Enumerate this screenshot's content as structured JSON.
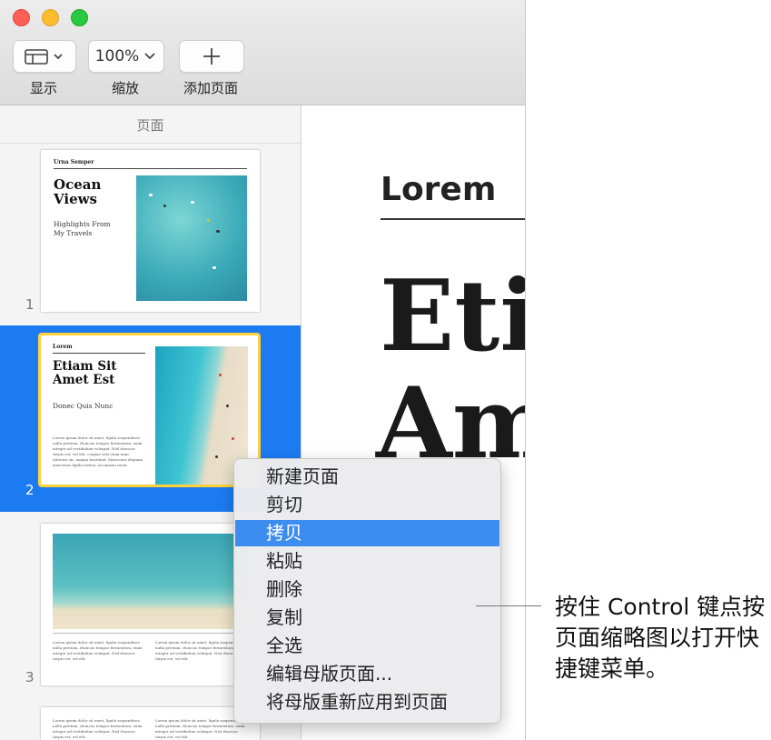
{
  "toolbar": {
    "view_label": "显示",
    "zoom_value": "100%",
    "zoom_label": "缩放",
    "add_page_label": "添加页面"
  },
  "sidebar": {
    "title": "页面",
    "pages": [
      {
        "number": "1",
        "kicker": "Urna Semper",
        "title": "Ocean Views",
        "subtitle": "Highlights From My Travels"
      },
      {
        "number": "2",
        "kicker": "Lorem",
        "title": "Etiam Sit Amet Est",
        "subtitle": "Donec Quis Nunc",
        "body": "Lorem ipsum dolor sit amet, ligula suspendisse nulla pretium, rhoncus tempor fermentum, enim integer ad vestibulum volutpat. Nisl rhoncus turpis est, vel elit, congue wisi enim nunc ultricies sit, magna tincidunt. Maecenas aliquam maecenas ligula nostra, accumsan taciti."
      },
      {
        "number": "3",
        "body": "Lorem ipsum dolor sit amet, ligula suspendisse nulla pretium, rhoncus tempor fermentum, enim integer ad vestibulum volutpat. Nisl rhoncus turpis est, vel elit."
      }
    ]
  },
  "document": {
    "kicker": "Lorem",
    "title_line1": "Etia",
    "title_line2": "Am"
  },
  "context_menu": {
    "items": [
      "新建页面",
      "剪切",
      "拷贝",
      "粘贴",
      "删除",
      "复制",
      "全选",
      "编辑母版页面...",
      "将母版重新应用到页面"
    ],
    "highlighted": "拷贝"
  },
  "callout": {
    "text": "按住 Control 键点按页面缩略图以打开快捷键菜单。"
  },
  "colors": {
    "selection": "#1d7bf2",
    "menu_highlight": "#3d8cf0",
    "thumb_border": "#ffd23d"
  }
}
